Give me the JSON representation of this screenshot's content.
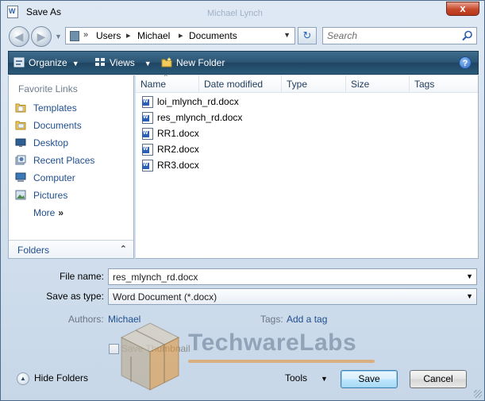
{
  "window": {
    "title": "Save As",
    "ghost_title": "Michael Lynch",
    "close_label": "x"
  },
  "address": {
    "crumbs": [
      "Users",
      "Michael",
      "Documents"
    ],
    "separator": "»",
    "search_placeholder": "Search"
  },
  "toolbar": {
    "organize_label": "Organize",
    "views_label": "Views",
    "new_folder_label": "New Folder",
    "help_label": "?"
  },
  "sidebar": {
    "favorites_header": "Favorite Links",
    "items": [
      {
        "label": "Templates",
        "icon": "templates-folder-icon"
      },
      {
        "label": "Documents",
        "icon": "documents-folder-icon"
      },
      {
        "label": "Desktop",
        "icon": "desktop-icon"
      },
      {
        "label": "Recent Places",
        "icon": "recent-places-icon"
      },
      {
        "label": "Computer",
        "icon": "computer-icon"
      },
      {
        "label": "Pictures",
        "icon": "pictures-icon"
      }
    ],
    "more_label": "More",
    "more_arrows": "»",
    "folders_label": "Folders",
    "folders_chevron": "⌃"
  },
  "filelist": {
    "columns": [
      "Name",
      "Date modified",
      "Type",
      "Size",
      "Tags"
    ],
    "files": [
      "loi_mlynch_rd.docx",
      "res_mlynch_rd.docx",
      "RR1.docx",
      "RR2.docx",
      "RR3.docx"
    ]
  },
  "form": {
    "filename_label": "File name:",
    "filename_value": "res_mlynch_rd.docx",
    "savetype_label": "Save as type:",
    "savetype_value": "Word Document (*.docx)",
    "authors_label": "Authors:",
    "authors_value": "Michael",
    "tags_label": "Tags:",
    "tags_value": "Add a tag",
    "thumbnail_label": "Save Thumbnail"
  },
  "footer": {
    "hide_folders_label": "Hide Folders",
    "tools_label": "Tools",
    "save_label": "Save",
    "cancel_label": "Cancel"
  },
  "watermark": {
    "text": "TechwareLabs"
  },
  "colors": {
    "toolbar": "#2b5473",
    "link": "#1f4e8f",
    "close": "#c6482a"
  }
}
